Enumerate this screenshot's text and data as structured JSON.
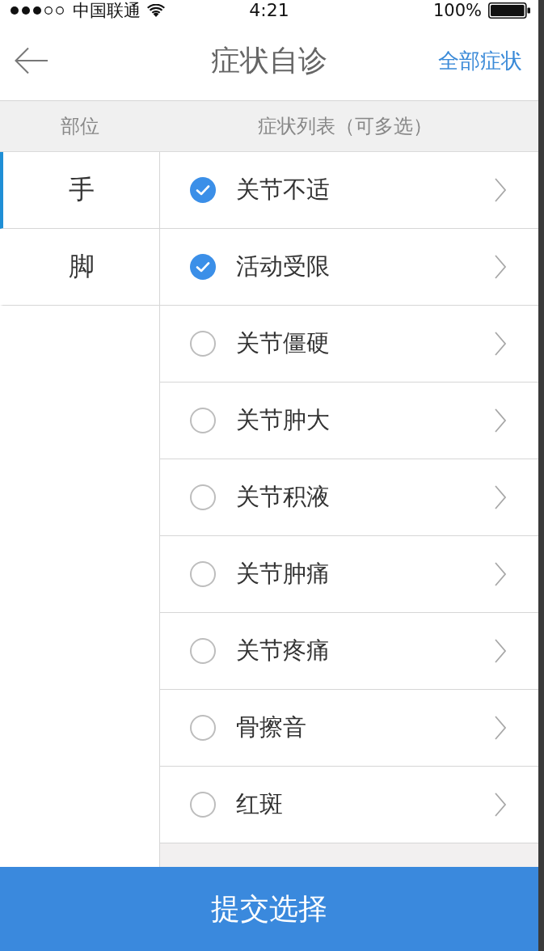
{
  "status_bar": {
    "carrier": "中国联通",
    "time": "4:21",
    "battery": "100%"
  },
  "nav": {
    "title": "症状自诊",
    "action": "全部症状"
  },
  "columns": [
    "部位",
    "症状列表（可多选）"
  ],
  "body_parts": [
    {
      "label": "手",
      "selected": true
    },
    {
      "label": "脚",
      "selected": false
    }
  ],
  "symptoms": [
    {
      "label": "关节不适",
      "checked": true
    },
    {
      "label": "活动受限",
      "checked": true
    },
    {
      "label": "关节僵硬",
      "checked": false
    },
    {
      "label": "关节肿大",
      "checked": false
    },
    {
      "label": "关节积液",
      "checked": false
    },
    {
      "label": "关节肿痛",
      "checked": false
    },
    {
      "label": "关节疼痛",
      "checked": false
    },
    {
      "label": "骨擦音",
      "checked": false
    },
    {
      "label": "红斑",
      "checked": false
    }
  ],
  "submit_button": "提交选择"
}
